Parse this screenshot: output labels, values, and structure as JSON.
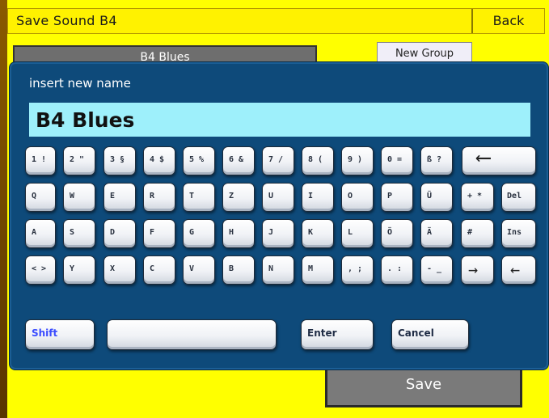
{
  "header": {
    "title": "Save Sound B4",
    "back_label": "Back"
  },
  "background": {
    "group_item": "B4 Blues",
    "new_group_label": "New Group",
    "save_label": "Save"
  },
  "dialog": {
    "prompt": "insert new name",
    "name_value": "B4 Blues",
    "keys": {
      "row1": [
        "1 !",
        "2 \"",
        "3 §",
        "4 $",
        "5 %",
        "6 &",
        "7 /",
        "8 (",
        "9 )",
        "0 =",
        "ß ?"
      ],
      "row2": [
        "Q",
        "W",
        "E",
        "R",
        "T",
        "Z",
        "U",
        "I",
        "O",
        "P",
        "Ü",
        "+ *",
        "Del"
      ],
      "row3": [
        "A",
        "S",
        "D",
        "F",
        "G",
        "H",
        "J",
        "K",
        "L",
        "Ö",
        "Ä",
        "#",
        "Ins"
      ],
      "row4": [
        "< >",
        "Y",
        "X",
        "C",
        "V",
        "B",
        "N",
        "M",
        ", ;",
        ". :",
        "- _"
      ],
      "shift": "Shift",
      "enter": "Enter",
      "cancel": "Cancel"
    }
  },
  "colors": {
    "background": "#ffff00",
    "dialog": "#0e4a7a",
    "name_field": "#9ef0fb"
  }
}
